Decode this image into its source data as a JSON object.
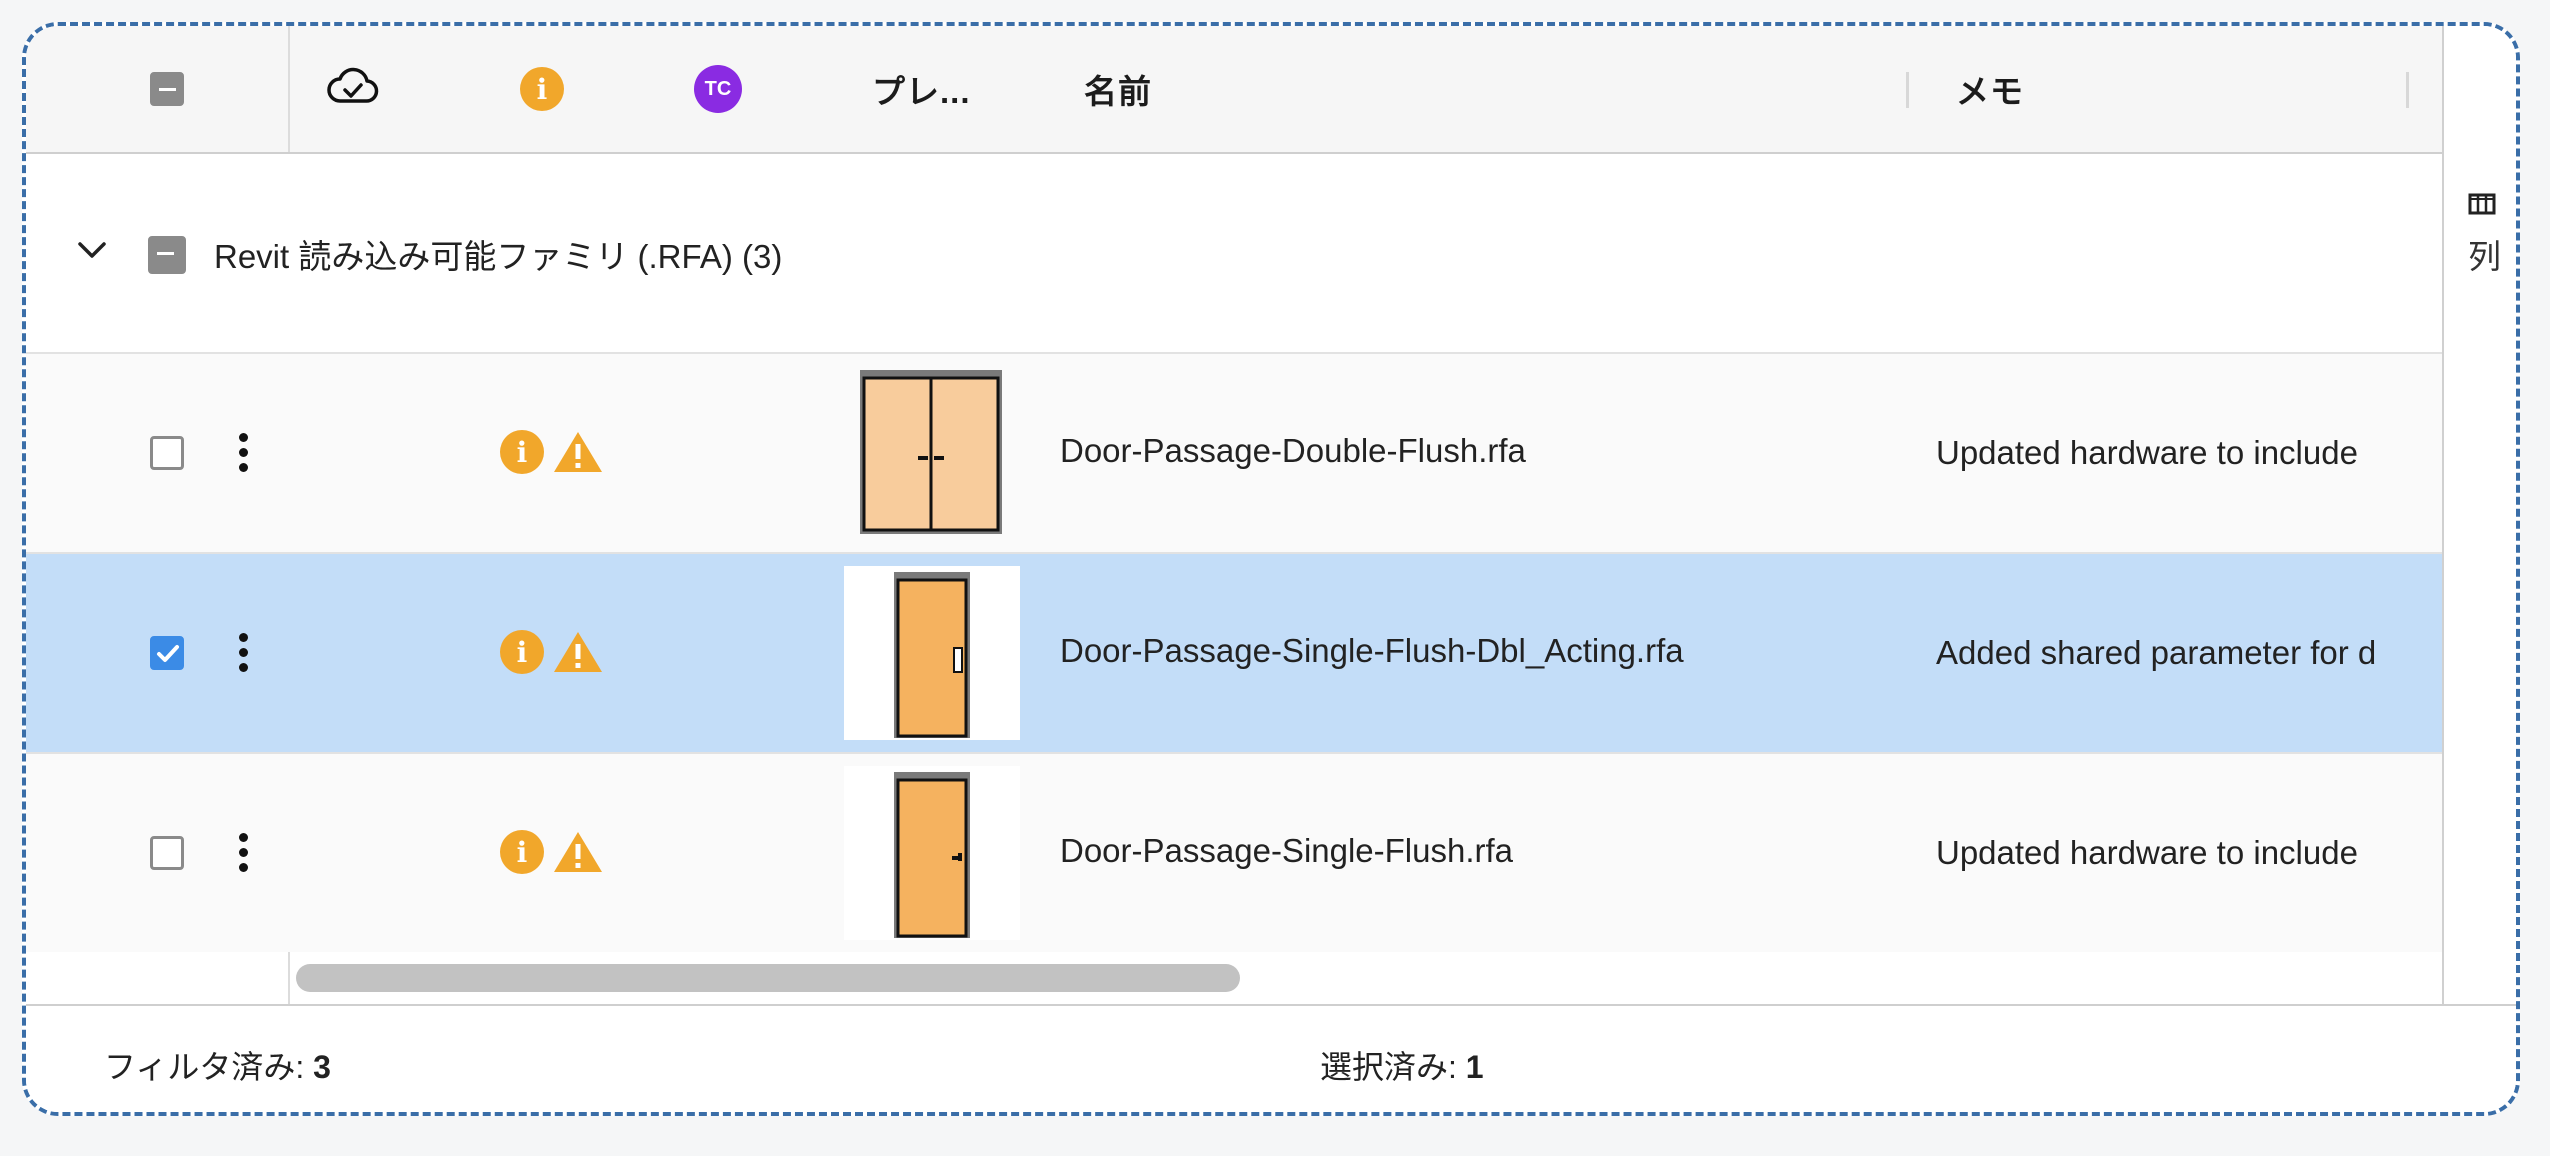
{
  "header": {
    "cloud_icon": "cloud-check-icon",
    "info_icon": "info-icon",
    "avatar_initials": "TC",
    "preview_label": "プレ...",
    "name_label": "名前",
    "memo_label": "メモ"
  },
  "group": {
    "label": "Revit 読み込み可能ファミリ (.RFA) (3)"
  },
  "rows": [
    {
      "name": "Door-Passage-Double-Flush.rfa",
      "memo": "Updated hardware to include",
      "checked": false,
      "thumbnail": "double-door"
    },
    {
      "name": "Door-Passage-Single-Flush-Dbl_Acting.rfa",
      "memo": "Added shared parameter for d",
      "checked": true,
      "thumbnail": "single-door-dbl-acting"
    },
    {
      "name": "Door-Passage-Single-Flush.rfa",
      "memo": "Updated hardware to include",
      "checked": false,
      "thumbnail": "single-door"
    }
  ],
  "side_panel": {
    "columns_label": "列",
    "icon": "columns-icon"
  },
  "footer": {
    "filtered_label": "フィルタ済み:",
    "filtered_count": "3",
    "selected_label": "選択済み:",
    "selected_count": "1"
  },
  "colors": {
    "selected_row": "#c3ddf8",
    "checkbox_checked": "#3b8be6",
    "warning": "#f1a72b",
    "avatar": "#8a2be2",
    "frame_border": "#3a6ea8"
  }
}
